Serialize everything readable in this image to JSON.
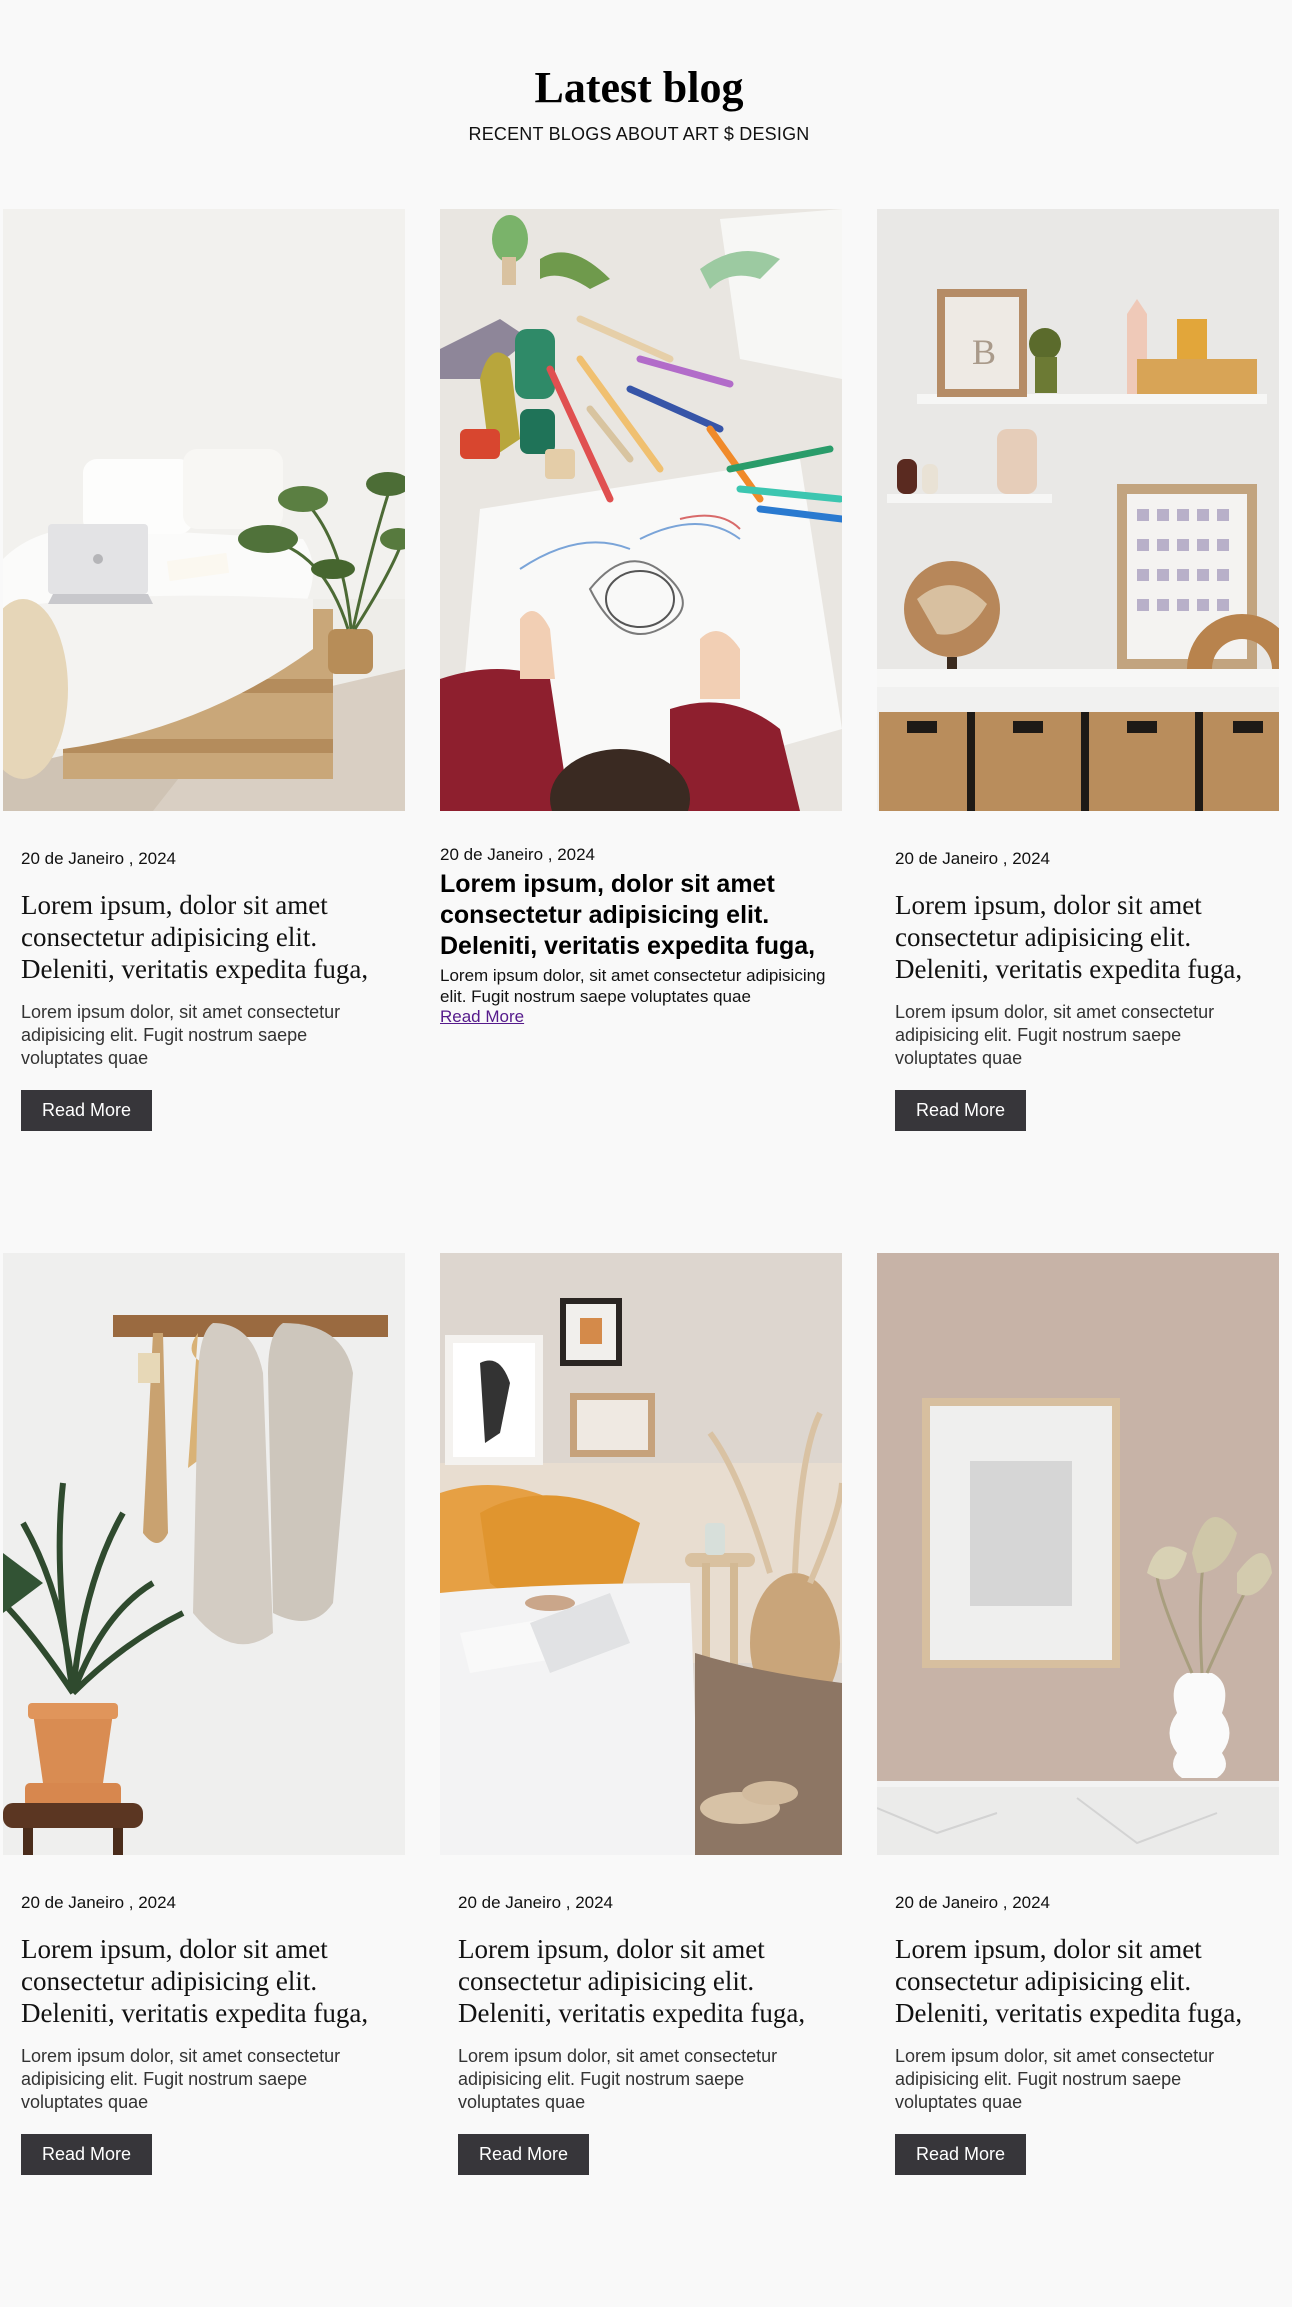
{
  "header": {
    "title": "Latest blog",
    "subtitle": "RECENT BLOGS ABOUT ART $ DESIGN"
  },
  "posts": [
    {
      "image": "bedroom-laptop-photo",
      "date": "20 de Janeiro , 2024",
      "title": "Lorem ipsum, dolor sit amet consectetur adipisicing elit. Deleniti, veritatis expedita fuga,",
      "excerpt": "Lorem ipsum dolor, sit amet consectetur adipisicing elit. Fugit nostrum saepe voluptates quae",
      "button": "Read More"
    },
    {
      "image": "child-drawing-photo",
      "date": "20 de Janeiro , 2024",
      "title": "Lorem ipsum, dolor sit amet consectetur adipisicing elit. Deleniti, veritatis expedita fuga,",
      "excerpt": "Lorem ipsum dolor, sit amet consectetur adipisicing elit. Fugit nostrum saepe voluptates quae",
      "button": "Read More"
    },
    {
      "image": "kids-shelf-photo",
      "date": "20 de Janeiro , 2024",
      "title": "Lorem ipsum, dolor sit amet consectetur adipisicing elit. Deleniti, veritatis expedita fuga,",
      "excerpt": "Lorem ipsum dolor, sit amet consectetur adipisicing elit. Fugit nostrum saepe voluptates quae",
      "button": "Read More"
    },
    {
      "image": "towels-plant-photo",
      "date": "20 de Janeiro , 2024",
      "title": "Lorem ipsum, dolor sit amet consectetur adipisicing elit. Deleniti, veritatis expedita fuga,",
      "excerpt": "Lorem ipsum dolor, sit amet consectetur adipisicing elit. Fugit nostrum saepe voluptates quae",
      "button": "Read More"
    },
    {
      "image": "cozy-bed-photo",
      "date": "20 de Janeiro , 2024",
      "title": "Lorem ipsum, dolor sit amet consectetur adipisicing elit. Deleniti, veritatis expedita fuga,",
      "excerpt": "Lorem ipsum dolor, sit amet consectetur adipisicing elit. Fugit nostrum saepe voluptates quae",
      "button": "Read More"
    },
    {
      "image": "frame-vase-photo",
      "date": "20 de Janeiro , 2024",
      "title": "Lorem ipsum, dolor sit amet consectetur adipisicing elit. Deleniti, veritatis expedita fuga,",
      "excerpt": "Lorem ipsum dolor, sit amet consectetur adipisicing elit. Fugit nostrum saepe voluptates quae",
      "button": "Read More"
    }
  ]
}
